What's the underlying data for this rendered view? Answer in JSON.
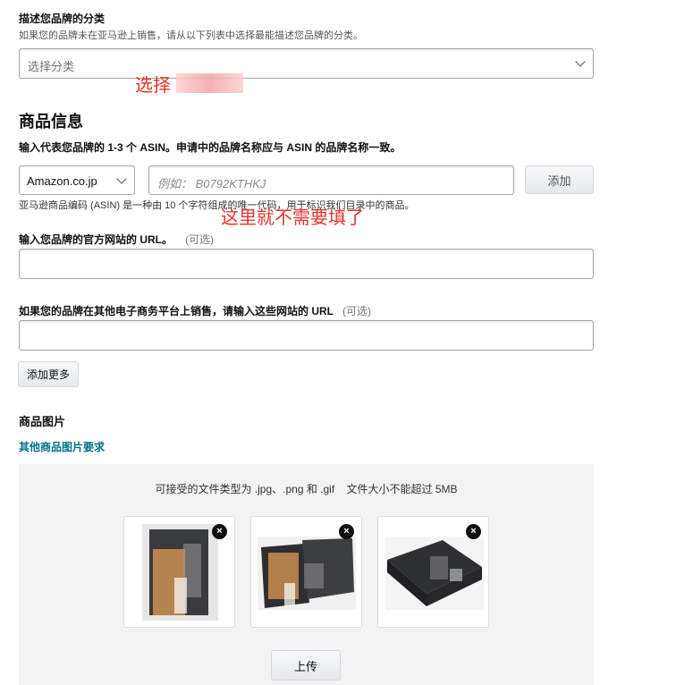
{
  "category": {
    "title": "描述您品牌的分类",
    "hint": "如果您的品牌未在亚马逊上销售，请从以下列表中选择最能描述您品牌的分类。",
    "placeholder": "选择分类",
    "annotation": "选择"
  },
  "product_info": {
    "heading": "商品信息",
    "asin_label": "输入代表您品牌的 1-3 个 ASIN。申请中的品牌名称应与 ASIN 的品牌名称一致。",
    "marketplace": "Amazon.co.jp",
    "asin_placeholder": "例如： B0792KTHKJ",
    "add_button": "添加",
    "asin_hint": "亚马逊商品编码 (ASIN) 是一种由 10 个字符组成的唯一代码，用于标识我们目录中的商品。",
    "annotation": "这里就不需要填了",
    "website_label": "输入您品牌的官方网站的 URL。",
    "optional": "(可选)",
    "other_sites_label": "如果您的品牌在其他电子商务平台上销售，请输入这些网站的 URL",
    "add_more": "添加更多"
  },
  "images": {
    "title": "商品图片",
    "requirements_link": "其他商品图片要求",
    "accepted_text": "可接受的文件类型为 .jpg、.png 和 .gif    文件大小不能超过 5MB",
    "upload_button": "上传",
    "remove_icon_glyph": "×"
  },
  "colors": {
    "link": "#007185",
    "annotation": "#e8322b",
    "upload_area": "#f3f3f3"
  }
}
